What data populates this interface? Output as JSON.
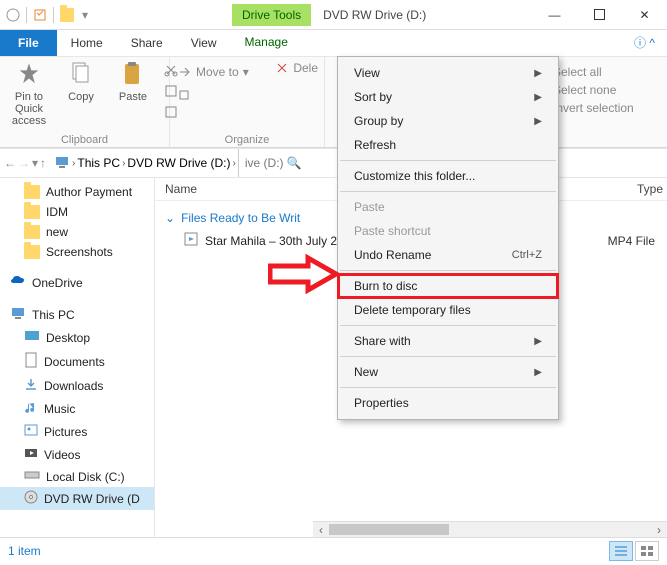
{
  "window": {
    "drive_tools_label": "Drive Tools",
    "title": "DVD RW Drive (D:)"
  },
  "tabs": {
    "file": "File",
    "home": "Home",
    "share": "Share",
    "view": "View",
    "manage": "Manage"
  },
  "ribbon": {
    "pin": "Pin to Quick\naccess",
    "copy": "Copy",
    "paste": "Paste",
    "clipboard_group": "Clipboard",
    "move_to": "Move to",
    "delete": "Dele",
    "organize_group": "Organize",
    "select_all": "Select all",
    "select_none": "Select none",
    "invert_sel": "Invert selection"
  },
  "breadcrumb": {
    "this_pc": "This PC",
    "drive": "DVD RW Drive (D:)",
    "search_placeholder": "ive (D:)"
  },
  "tree": {
    "author_payment": "Author Payment",
    "idm": "IDM",
    "new_folder": "new",
    "screenshots": "Screenshots",
    "onedrive": "OneDrive",
    "this_pc": "This PC",
    "desktop": "Desktop",
    "documents": "Documents",
    "downloads": "Downloads",
    "music": "Music",
    "pictures": "Pictures",
    "videos": "Videos",
    "local_disk": "Local Disk (C:)",
    "dvd_drive": "DVD RW Drive (D"
  },
  "columns": {
    "name": "Name",
    "type": "Type"
  },
  "content": {
    "group_header": "Files Ready to Be Writ",
    "file_name": "Star Mahila – 30th July 2",
    "file_type": "MP4 File"
  },
  "context_menu": {
    "view": "View",
    "sort_by": "Sort by",
    "group_by": "Group by",
    "refresh": "Refresh",
    "customize": "Customize this folder...",
    "paste": "Paste",
    "paste_shortcut": "Paste shortcut",
    "undo_rename": "Undo Rename",
    "undo_shortcut": "Ctrl+Z",
    "burn": "Burn to disc",
    "delete_temp": "Delete temporary files",
    "share_with": "Share with",
    "new": "New",
    "properties": "Properties"
  },
  "status": {
    "item_count": "1 item"
  }
}
